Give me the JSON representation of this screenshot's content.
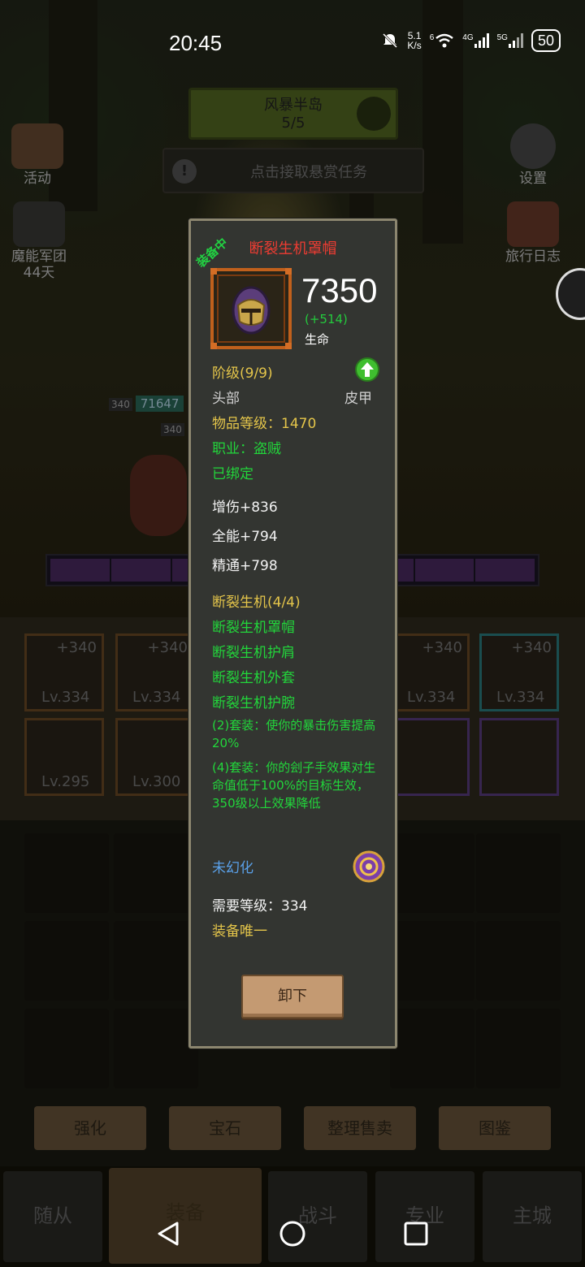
{
  "status_bar": {
    "time": "20:45",
    "net_speed_value": "5.1",
    "net_speed_unit": "K/s",
    "wifi_label": "6",
    "signal1_label": "4G",
    "signal2_label": "5G",
    "battery": "50"
  },
  "background": {
    "zone_name": "风暴半岛",
    "zone_progress": "5/5",
    "quest_text": "点击接取悬赏任务",
    "left_buttons": [
      {
        "label": "活动"
      },
      {
        "label": "魔能军团"
      },
      {
        "label": "44天"
      }
    ],
    "right_buttons": [
      {
        "label": "设置"
      },
      {
        "label": "旅行日志"
      }
    ],
    "char_level_a": "340",
    "char_hp": "71647",
    "char_level_b": "340",
    "equip_slots": [
      {
        "plus": "+340",
        "level": "Lv.334"
      },
      {
        "plus": "+340",
        "level": "Lv.334"
      },
      {
        "plus": "+340",
        "level": "Lv.334"
      },
      {
        "plus": "+340",
        "level": "Lv.334"
      },
      {
        "plus": "",
        "level": "Lv.295"
      },
      {
        "plus": "",
        "level": "Lv.300"
      }
    ],
    "actions": [
      "强化",
      "宝石",
      "整理售卖",
      "图鉴"
    ],
    "nav_tabs": [
      "随从",
      "装备",
      "战斗",
      "专业",
      "主城"
    ]
  },
  "tooltip": {
    "badge": "装备中",
    "item_name": "断裂生机罩帽",
    "main_value": "7350",
    "main_delta": "(+514)",
    "main_stat": "生命",
    "tier": "阶级(9/9)",
    "slot": "头部",
    "armor_type": "皮甲",
    "item_level": "物品等级：1470",
    "class_req": "职业：盗贼",
    "bound": "已绑定",
    "stats": [
      "增伤+836",
      "全能+794",
      "精通+798"
    ],
    "set_name": "断裂生机(4/4)",
    "set_pieces": [
      "断裂生机罩帽",
      "断裂生机护肩",
      "断裂生机外套",
      "断裂生机护腕"
    ],
    "set_bonus_2": "(2)套装：使你的暴击伤害提高20%",
    "set_bonus_4": "(4)套装：你的刽子手效果对生命值低于100%的目标生效，350级以上效果降低",
    "transmog": "未幻化",
    "required_level": "需要等级：334",
    "unique": "装备唯一",
    "unequip_button": "卸下"
  },
  "colors": {
    "item_name": "#ee3c32",
    "yellow_text": "#e4c54a",
    "green_text": "#22d63b",
    "blue_text": "#5aa0e8",
    "tooltip_bg": "#333531",
    "tooltip_border": "#8c866f",
    "button_wood": "#c49a72"
  }
}
